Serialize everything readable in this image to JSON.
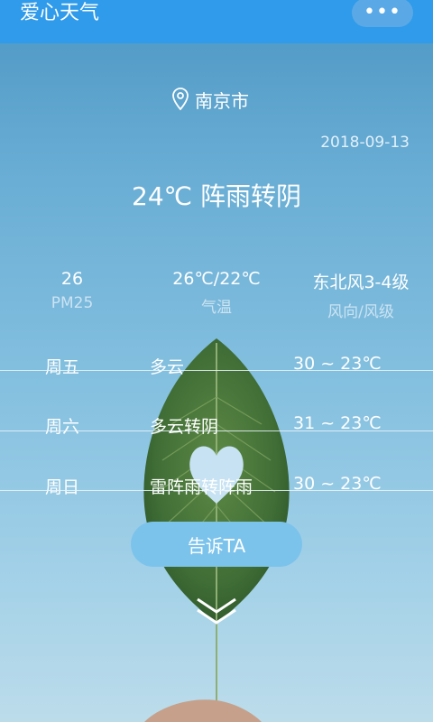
{
  "header": {
    "title": "爱心天气",
    "menu_label": "•••"
  },
  "location": {
    "icon": "location-pin-icon",
    "city": "南京市"
  },
  "date": "2018-09-13",
  "current": {
    "summary": "24℃ 阵雨转阴"
  },
  "stats": [
    {
      "value": "26",
      "label": "PM25"
    },
    {
      "value": "26℃/22℃",
      "label": "气温"
    },
    {
      "value": "东北风3-4级",
      "label": "风向/风级"
    }
  ],
  "forecast": [
    {
      "day": "周五",
      "weather": "多云",
      "temp": "30 ~ 23℃"
    },
    {
      "day": "周六",
      "weather": "多云转阴",
      "temp": "31 ~ 23℃"
    },
    {
      "day": "周日",
      "weather": "雷阵雨转阵雨",
      "temp": "30 ~ 23℃"
    }
  ],
  "tell_button": "告诉TA",
  "scroll_icon": "double-chevron-down-icon"
}
